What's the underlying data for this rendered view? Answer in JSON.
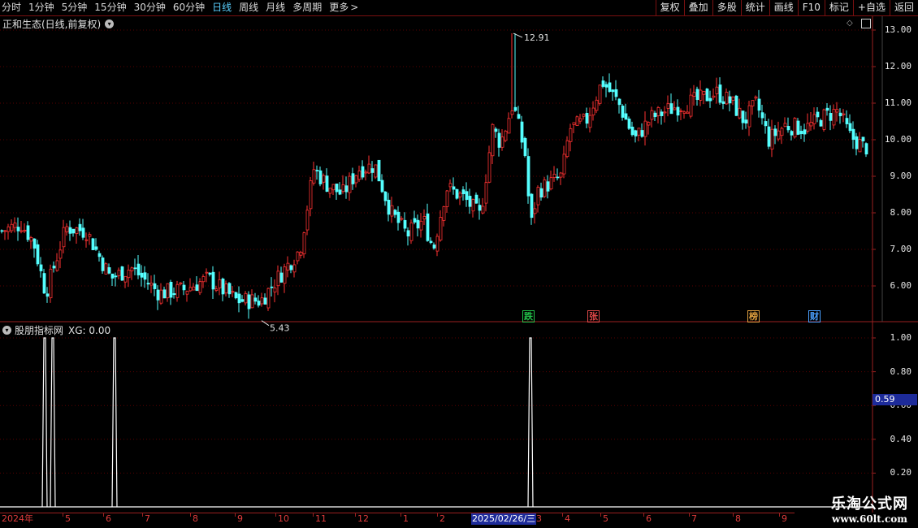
{
  "toolbar": {
    "periods": [
      "分时",
      "1分钟",
      "5分钟",
      "15分钟",
      "30分钟",
      "60分钟",
      "日线",
      "周线",
      "月线",
      "多周期",
      "更多"
    ],
    "active_period": "日线",
    "more_arrow": ">",
    "buttons": [
      "复权",
      "叠加",
      "多股",
      "统计",
      "画线",
      "F10",
      "标记",
      "+自选",
      "返回"
    ]
  },
  "main_chart": {
    "title": "正和生态(日线,前复权)",
    "y_ticks": [
      "13.00",
      "12.00",
      "11.00",
      "10.00",
      "9.00",
      "8.00",
      "7.00",
      "6.00"
    ],
    "high_label": "12.91",
    "low_label": "5.43",
    "markers": [
      {
        "text": "跌",
        "color": "#22c24a"
      },
      {
        "text": "张",
        "color": "#e04848"
      },
      {
        "text": "榜",
        "color": "#e0a040"
      },
      {
        "text": "财",
        "color": "#4aa0ff"
      }
    ]
  },
  "indicator": {
    "title": "股朋指标网",
    "formula": "XG: 0.00",
    "y_ticks": [
      "1.00",
      "0.80",
      "0.60",
      "0.40",
      "0.20"
    ],
    "cursor_value": "0.59"
  },
  "dates": {
    "ticks": [
      "2024年",
      "5",
      "6",
      "7",
      "8",
      "9",
      "10",
      "11",
      "12",
      "1",
      "2",
      "3",
      "4",
      "5",
      "6",
      "7",
      "8",
      "9",
      "10"
    ],
    "selected": "2025/02/26/三"
  },
  "watermark": {
    "line1": "乐淘公式网",
    "line2": "www.60lt.com"
  },
  "colors": {
    "up": "#ff3232",
    "down": "#54ffff",
    "grid": "#5a0000",
    "border": "#9a2020"
  },
  "chart_data": {
    "type": "candlestick",
    "close_anchors": [
      [
        0,
        7.5
      ],
      [
        25,
        7.7
      ],
      [
        40,
        7.2
      ],
      [
        55,
        5.8
      ],
      [
        80,
        7.6
      ],
      [
        105,
        7.5
      ],
      [
        135,
        6.2
      ],
      [
        160,
        6.5
      ],
      [
        195,
        5.8
      ],
      [
        225,
        5.9
      ],
      [
        255,
        6.2
      ],
      [
        290,
        5.6
      ],
      [
        320,
        5.6
      ],
      [
        340,
        6.2
      ],
      [
        368,
        7.0
      ],
      [
        385,
        9.2
      ],
      [
        400,
        8.8
      ],
      [
        420,
        8.5
      ],
      [
        440,
        9.2
      ],
      [
        460,
        9.3
      ],
      [
        480,
        8.0
      ],
      [
        500,
        7.4
      ],
      [
        520,
        7.8
      ],
      [
        532,
        7.0
      ],
      [
        548,
        8.7
      ],
      [
        570,
        8.4
      ],
      [
        590,
        7.9
      ],
      [
        605,
        10.3
      ],
      [
        615,
        9.9
      ],
      [
        630,
        11.0
      ],
      [
        645,
        9.6
      ],
      [
        652,
        7.6
      ],
      [
        660,
        8.6
      ],
      [
        690,
        9.0
      ],
      [
        700,
        10.3
      ],
      [
        720,
        10.5
      ],
      [
        740,
        11.6
      ],
      [
        760,
        11.0
      ],
      [
        780,
        10.0
      ],
      [
        800,
        10.6
      ],
      [
        830,
        10.9
      ],
      [
        860,
        11.1
      ],
      [
        880,
        11.3
      ],
      [
        900,
        11.0
      ],
      [
        915,
        10.5
      ],
      [
        930,
        11.0
      ],
      [
        945,
        10.0
      ],
      [
        965,
        10.4
      ],
      [
        990,
        10.3
      ],
      [
        1010,
        10.6
      ],
      [
        1030,
        10.8
      ],
      [
        1045,
        10.1
      ],
      [
        1062,
        9.8
      ]
    ],
    "indicator_spikes": [
      55,
      65,
      141,
      653
    ],
    "indicator_values": [
      1,
      1,
      1,
      1
    ]
  }
}
